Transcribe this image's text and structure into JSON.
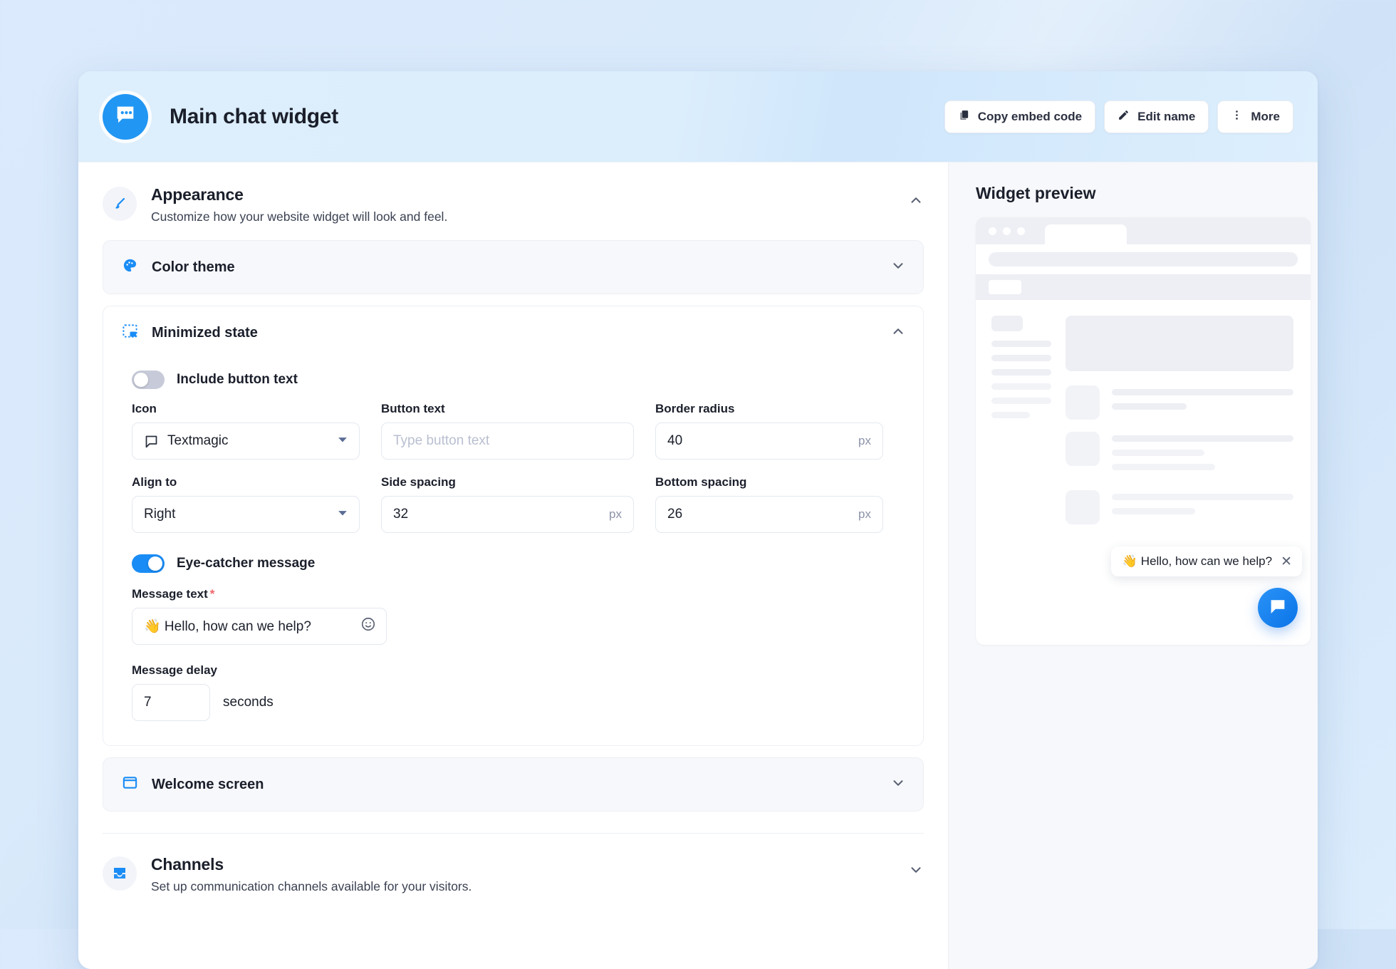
{
  "header": {
    "title": "Main chat widget",
    "logo_icon": "chat-bubble-icon",
    "actions": [
      {
        "label": "Copy embed code",
        "icon": "copy-icon"
      },
      {
        "label": "Edit name",
        "icon": "pencil-icon"
      },
      {
        "label": "More",
        "icon": "kebab-menu-icon"
      }
    ]
  },
  "appearance": {
    "title": "Appearance",
    "subtitle": "Customize how your website widget will look and feel.",
    "icon": "paintbrush-icon",
    "state": "expanded",
    "panels": {
      "color_theme": {
        "title": "Color theme",
        "icon": "palette-icon",
        "state": "collapsed"
      },
      "minimized_state": {
        "title": "Minimized state",
        "icon": "minimized-window-icon",
        "state": "expanded"
      },
      "welcome_screen": {
        "title": "Welcome screen",
        "icon": "window-icon",
        "state": "collapsed"
      }
    }
  },
  "minimized_state": {
    "include_button_text": {
      "label": "Include button text",
      "value": "off"
    },
    "icon_field": {
      "label": "Icon",
      "value": "Textmagic",
      "icon": "textmagic-bubble-icon"
    },
    "button_text_field": {
      "label": "Button text",
      "value": "",
      "placeholder": "Type button text"
    },
    "border_radius_field": {
      "label": "Border radius",
      "value": "40",
      "unit": "px"
    },
    "align_to_field": {
      "label": "Align to",
      "value": "Right"
    },
    "side_spacing_field": {
      "label": "Side spacing",
      "value": "32",
      "unit": "px"
    },
    "bottom_spacing_field": {
      "label": "Bottom spacing",
      "value": "26",
      "unit": "px"
    },
    "eye_catcher": {
      "label": "Eye-catcher message",
      "value": "on"
    },
    "message_text": {
      "label": "Message text",
      "required": "*",
      "value": "👋 Hello, how can we help?"
    },
    "message_delay": {
      "label": "Message delay",
      "value": "7",
      "unit": "seconds"
    }
  },
  "channels": {
    "title": "Channels",
    "subtitle": "Set up communication channels available for your visitors.",
    "icon": "inbox-icon",
    "state": "collapsed"
  },
  "preview": {
    "title": "Widget preview",
    "eye_catcher_text": "👋 Hello, how can we help?",
    "close_icon": "close-icon",
    "fab_icon": "chat-bubble-icon"
  },
  "colors": {
    "accent": "#1a8cf5",
    "brand_blue": "#2196f3",
    "text_dark": "#1b1f2b",
    "required_red": "#f0656a",
    "page_bg": "#dbeafc"
  }
}
